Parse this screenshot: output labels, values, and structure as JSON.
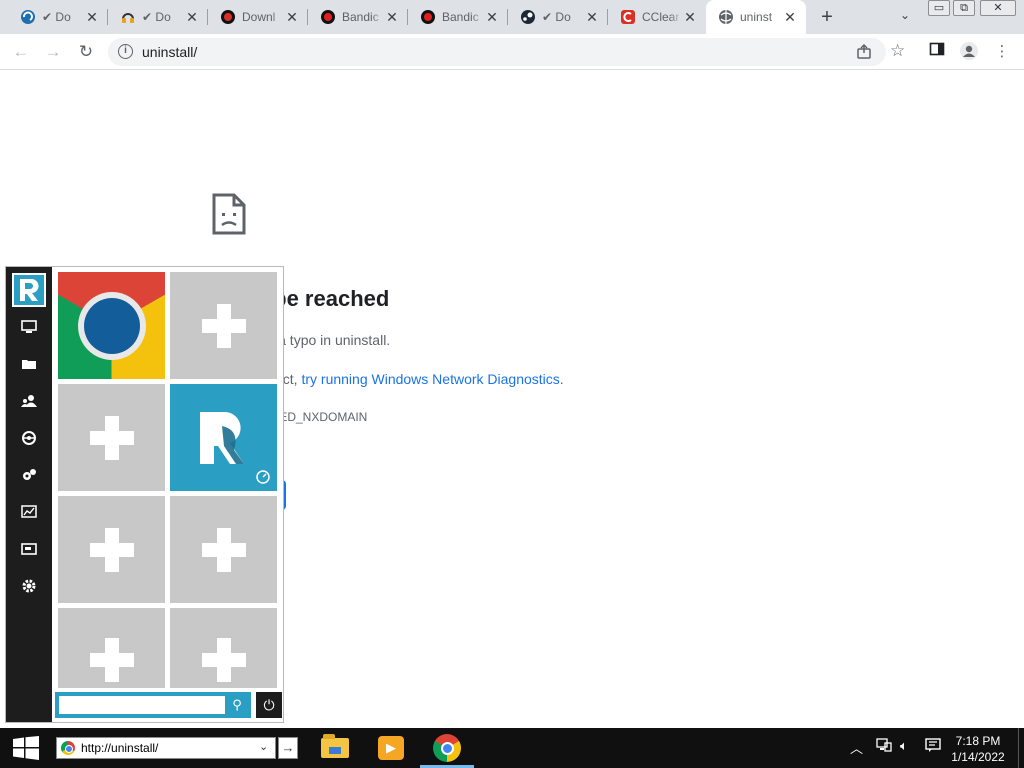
{
  "browser": {
    "tabs": [
      {
        "title": "Do",
        "icon": "ccleaner-downloading-icon",
        "prefix": "✔"
      },
      {
        "title": "Do",
        "icon": "headset-downloading-icon",
        "prefix": "✔"
      },
      {
        "title": "Downl",
        "icon": "download-site-icon",
        "prefix": ""
      },
      {
        "title": "Bandic",
        "icon": "bandicam-icon",
        "prefix": ""
      },
      {
        "title": "Bandic",
        "icon": "bandicam-icon",
        "prefix": ""
      },
      {
        "title": "Do",
        "icon": "steam-downloading-icon",
        "prefix": "✔"
      },
      {
        "title": "CClear",
        "icon": "ccleaner-icon",
        "prefix": ""
      },
      {
        "title": "uninst",
        "icon": "globe-icon",
        "prefix": "",
        "active": true
      }
    ],
    "new_tab_label": "+",
    "tab_search_label": "⌄",
    "window_controls": {
      "minimize": "▭",
      "restore": "⧉",
      "close": "✕"
    },
    "url": "uninstall/"
  },
  "error_page": {
    "title": "te can’t be reached",
    "line1": "ere is a typo in uninstall.",
    "line2_prefix": "s correct, ",
    "line2_link": "try running Windows Network Diagnostics",
    "line2_suffix": ".",
    "code": "FINISHED_NXDOMAIN"
  },
  "start_menu": {
    "sidebar_items": [
      "computer-icon",
      "folder-icon",
      "users-icon",
      "network-icon",
      "control-panel-icon",
      "performance-icon",
      "display-icon",
      "settings-icon"
    ],
    "tiles": [
      "chrome",
      "add",
      "add",
      "app",
      "add",
      "add",
      "add",
      "add"
    ],
    "search_value": "",
    "accent": "#2b9ec4"
  },
  "taskbar": {
    "address_value": "http://uninstall/",
    "go_label": "→",
    "apps": [
      "file-explorer",
      "media-player",
      "chrome"
    ],
    "time": "7:18 PM",
    "date": "1/14/2022"
  }
}
